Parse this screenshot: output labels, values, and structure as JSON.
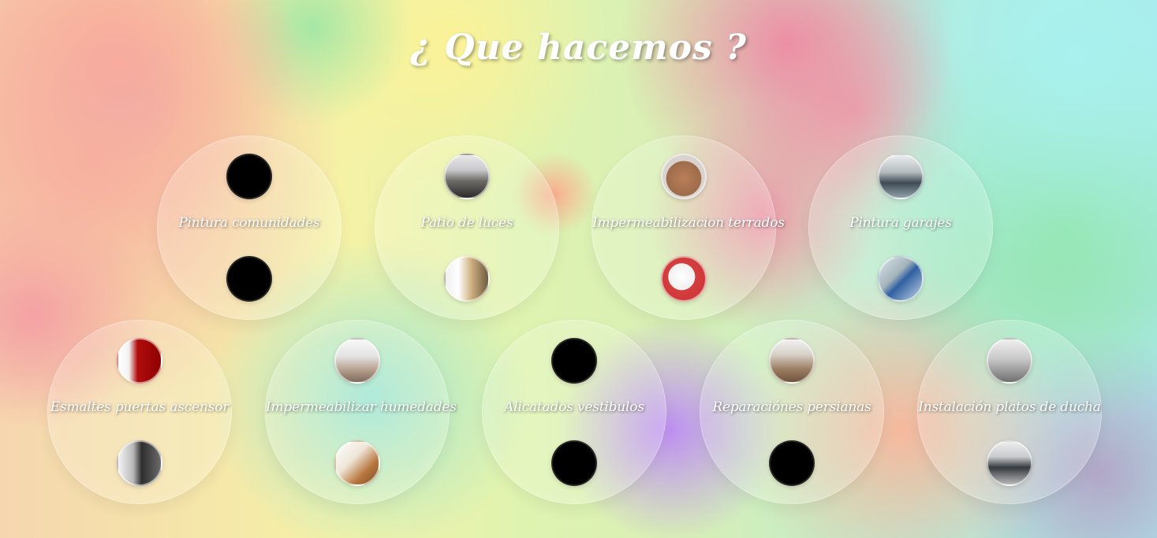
{
  "heading": {
    "title": "¿ Que hacemos ?"
  },
  "services": {
    "row1": [
      {
        "label": "Pintura comunidades",
        "top_image": "black-image",
        "bottom_image": "black-image"
      },
      {
        "label": "Patio de luces",
        "top_image": "hallway-photo",
        "bottom_image": "corridor-photo"
      },
      {
        "label": "Impermeabilizacion terrados",
        "top_image": "rooftop-photo",
        "bottom_image": "red-terrace-photo"
      },
      {
        "label": "Pintura garajes",
        "top_image": "garage-photo",
        "bottom_image": "garage-floor-photo"
      }
    ],
    "row2": [
      {
        "label": "Esmaltes puertas ascensor",
        "top_image": "red-elevator-door-photo",
        "bottom_image": "grey-elevator-door-photo"
      },
      {
        "label": "Impermeabilizar humedades",
        "top_image": "white-room-photo",
        "bottom_image": "damp-wall-photo"
      },
      {
        "label": "Alicatados vestibulos",
        "top_image": "black-image",
        "bottom_image": "black-image"
      },
      {
        "label": "Reparaciónes persianas",
        "top_image": "window-frame-photo",
        "bottom_image": "black-image"
      },
      {
        "label": "Instalación platos de ducha",
        "top_image": "tiled-wall-photo",
        "bottom_image": "shower-photo"
      }
    ]
  }
}
